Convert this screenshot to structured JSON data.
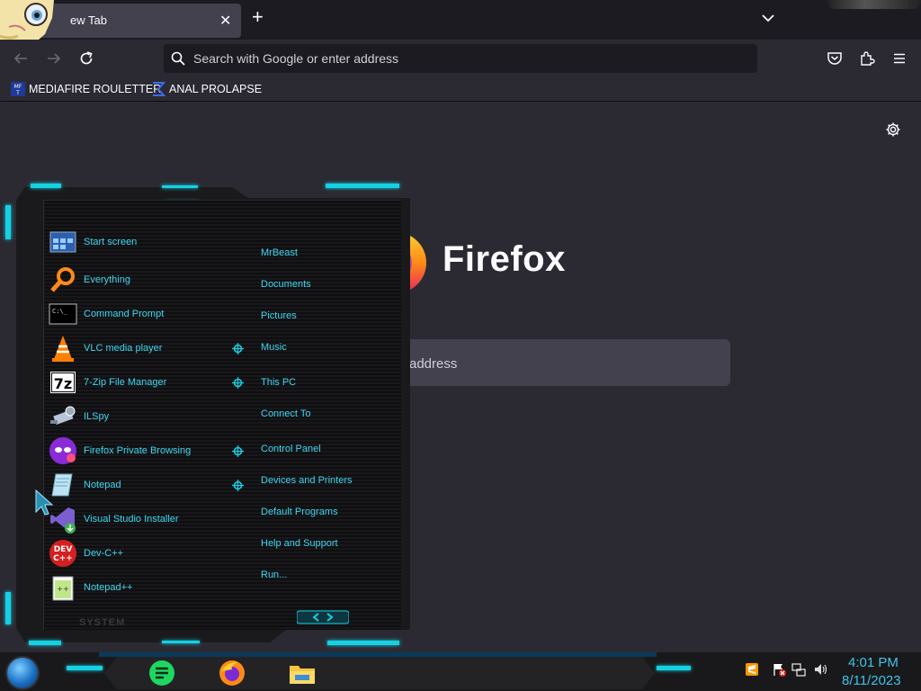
{
  "browser": {
    "tab": {
      "title": "New Tab",
      "title_visible": "ew Tab"
    },
    "urlbar": {
      "placeholder": "Search with Google or enter address"
    },
    "bookmarks": [
      {
        "label": "MEDIAFIRE ROULETTER",
        "favicon": "mft-icon"
      },
      {
        "label": "ANAL PROLAPSE",
        "favicon": "sigma-icon"
      }
    ],
    "newtab": {
      "brand": "Firefox",
      "search_placeholder_visible": "address"
    }
  },
  "startmenu": {
    "left_items": [
      {
        "label": "Start screen",
        "icon": "start-screen-icon"
      },
      {
        "label": "Everything",
        "icon": "magnifier-icon"
      },
      {
        "label": "Command Prompt",
        "icon": "cmd-icon"
      },
      {
        "label": "VLC media player",
        "icon": "vlc-cone-icon"
      },
      {
        "label": "7-Zip File Manager",
        "icon": "7zip-icon"
      },
      {
        "label": "ILSpy",
        "icon": "ilspy-icon"
      },
      {
        "label": "Firefox Private Browsing",
        "icon": "private-browsing-icon"
      },
      {
        "label": "Notepad",
        "icon": "notepad-icon"
      },
      {
        "label": "Visual Studio Installer",
        "icon": "vs-installer-icon"
      },
      {
        "label": "Dev-C++",
        "icon": "devcpp-icon"
      },
      {
        "label": "Notepad++",
        "icon": "notepadpp-icon"
      }
    ],
    "right_items": [
      {
        "label": "MrBeast"
      },
      {
        "label": "Documents"
      },
      {
        "label": "Pictures"
      },
      {
        "label": "Music"
      },
      {
        "label": "This PC"
      },
      {
        "label": "Connect To"
      },
      {
        "label": "Control Panel"
      },
      {
        "label": "Devices and Printers"
      },
      {
        "label": "Default Programs"
      },
      {
        "label": "Help and Support"
      },
      {
        "label": "Run..."
      }
    ],
    "system_label": "SYSTEM"
  },
  "taskbar": {
    "apps": [
      "notes-app-icon",
      "firefox-icon",
      "file-explorer-icon"
    ],
    "tray": [
      "sublime-icon",
      "flag-error-icon",
      "network-icon",
      "volume-icon"
    ],
    "clock": {
      "time": "4:01 PM",
      "date": "8/11/2023"
    }
  },
  "colors": {
    "accent_cyan": "#14d1e3",
    "menu_text": "#3fd7f0",
    "clock_text": "#3fc3e8",
    "browser_bg": "#2b2a33",
    "tabbar_bg": "#1c1b22"
  }
}
